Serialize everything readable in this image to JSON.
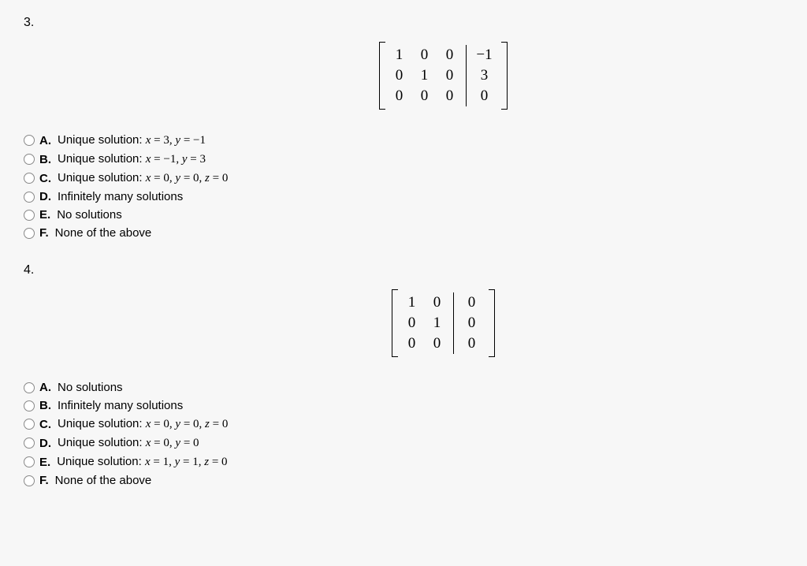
{
  "questions": [
    {
      "number": "3.",
      "matrix": {
        "rows": [
          {
            "left": [
              "1",
              "0",
              "0"
            ],
            "right": [
              "−1"
            ]
          },
          {
            "left": [
              "0",
              "1",
              "0"
            ],
            "right": [
              "3"
            ]
          },
          {
            "left": [
              "0",
              "0",
              "0"
            ],
            "right": [
              "0"
            ]
          }
        ]
      },
      "options": [
        {
          "label": "A.",
          "prefix": "Unique solution: ",
          "math": "x = 3, y = −1"
        },
        {
          "label": "B.",
          "prefix": "Unique solution: ",
          "math": "x = −1, y = 3"
        },
        {
          "label": "C.",
          "prefix": "Unique solution: ",
          "math": "x = 0, y = 0, z = 0"
        },
        {
          "label": "D.",
          "prefix": "Infinitely many solutions",
          "math": ""
        },
        {
          "label": "E.",
          "prefix": "No solutions",
          "math": ""
        },
        {
          "label": "F.",
          "prefix": "None of the above",
          "math": ""
        }
      ]
    },
    {
      "number": "4.",
      "matrix": {
        "rows": [
          {
            "left": [
              "1",
              "0"
            ],
            "right": [
              "0"
            ]
          },
          {
            "left": [
              "0",
              "1"
            ],
            "right": [
              "0"
            ]
          },
          {
            "left": [
              "0",
              "0"
            ],
            "right": [
              "0"
            ]
          }
        ]
      },
      "options": [
        {
          "label": "A.",
          "prefix": "No solutions",
          "math": ""
        },
        {
          "label": "B.",
          "prefix": "Infinitely many solutions",
          "math": ""
        },
        {
          "label": "C.",
          "prefix": "Unique solution: ",
          "math": "x = 0, y = 0, z = 0"
        },
        {
          "label": "D.",
          "prefix": "Unique solution: ",
          "math": "x = 0, y = 0"
        },
        {
          "label": "E.",
          "prefix": "Unique solution: ",
          "math": "x = 1, y = 1, z = 0"
        },
        {
          "label": "F.",
          "prefix": "None of the above",
          "math": ""
        }
      ]
    }
  ]
}
